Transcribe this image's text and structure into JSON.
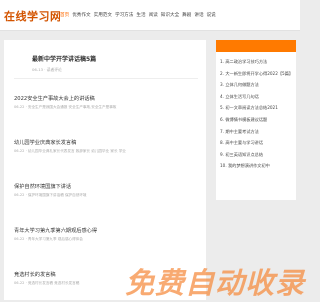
{
  "header": {
    "logo": "在线学习网",
    "nav": [
      "首页",
      "优秀作文",
      "实用范文",
      "学习方法",
      "生活",
      "阅读",
      "知识大全",
      "舞剧",
      "讲话",
      "说说"
    ]
  },
  "main": {
    "title": "最新中学开学讲话稿5篇",
    "date": "06-13 · 读者评论",
    "articles": [
      {
        "title": "2022安全生产事故大会上的讲话稿",
        "meta": "06-22 · 安全生产是我国大会通报 安全生产事故,安全生产是事故"
      },
      {
        "title": "幼儿园学业庆典家长发言稿",
        "meta": "06-22 · 幼儿园毕业典礼家长代表发言 致辞家长 幼儿园毕业 家长 学业"
      },
      {
        "title": "保护自然环境国旗下讲话",
        "meta": "06-22 · 保护环境国旗下讲话稿 保护自然环境"
      },
      {
        "title": "青年大学习第九季第六期观后感心得",
        "meta": "06-22 · 青年大学习第九季 观后感心得体会"
      },
      {
        "title": "竞选村长的发言稿",
        "meta": "06-22 · 竞选村长发言稿 竞选村长发言稿"
      }
    ]
  },
  "sidebar": {
    "items": [
      "1. 高二政治学习技巧方法",
      "2. 大一新生即将开学心得2022【5篇】",
      "3. 立体几何做题方法",
      "4. 立体生活写几句话",
      "5. 初一文章阅读方法总结2021",
      "6. 微博情书模板建议话题",
      "7. 期中主要考试方法",
      "8. 高中主要与学习讲话",
      "9. 初三英语知识点总结",
      "10. 我的梦想演讲作文初中"
    ]
  },
  "watermark": "免费自动收录"
}
